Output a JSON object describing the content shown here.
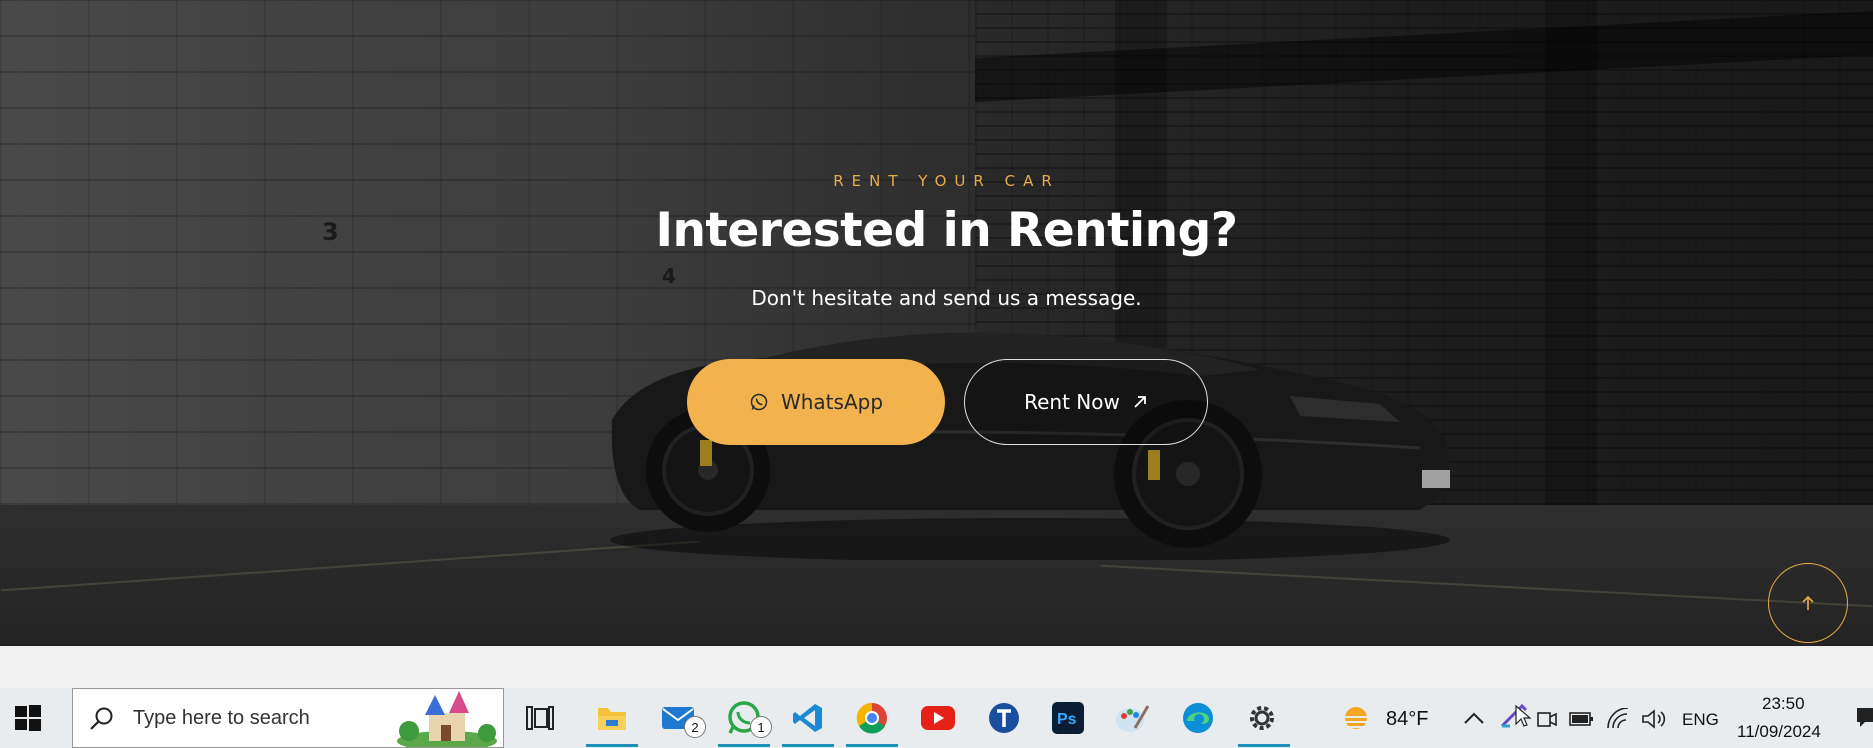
{
  "hero": {
    "eyebrow": "RENT YOUR CAR",
    "title": "Interested in Renting?",
    "subtitle": "Don't hesitate and send us a message.",
    "wall_numbers": [
      "3",
      "4"
    ],
    "whatsapp_label": "WhatsApp",
    "rent_label": "Rent Now",
    "accent_color": "#f2b24e"
  },
  "taskbar": {
    "search_placeholder": "Type here to search",
    "mail_badge": "2",
    "whatsapp_badge": "1",
    "weather_temp": "84°F",
    "language": "ENG",
    "time": "23:50",
    "date": "11/09/2024",
    "apps": [
      "task-view",
      "file-explorer",
      "mail",
      "whatsapp",
      "vscode",
      "chrome",
      "youtube",
      "teams-t",
      "photoshop",
      "paint",
      "edge",
      "settings"
    ]
  }
}
